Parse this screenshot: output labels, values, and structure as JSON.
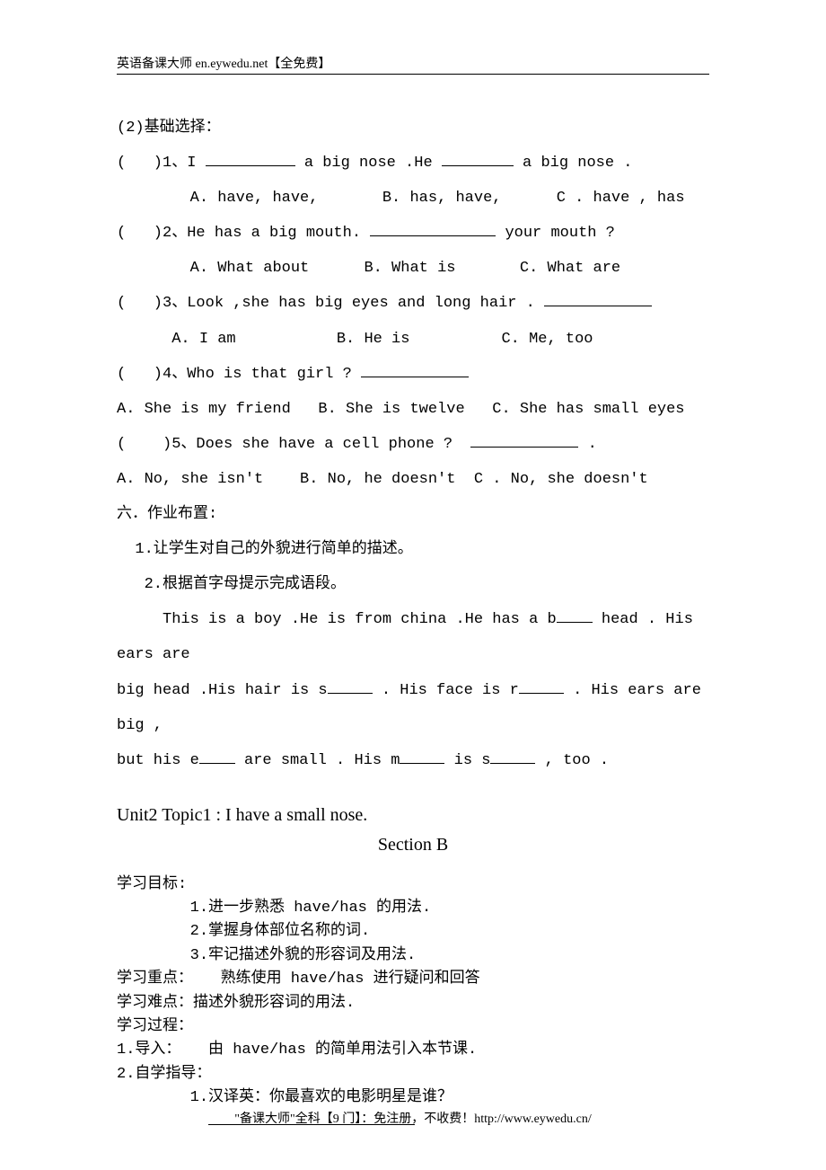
{
  "header": {
    "text": "英语备课大师  en.eywedu.net【全免费】"
  },
  "ex2": {
    "title": "(2)基础选择：",
    "q1": {
      "stem_a": "(   )1、I ",
      "stem_b": " a big nose .He ",
      "stem_c": " a big nose .",
      "opts": "        A. have, have,       B. has, have,      C . have , has"
    },
    "q2": {
      "stem_a": "(   )2、He has a big mouth. ",
      "stem_b": " your mouth ?",
      "opts": "        A. What about      B. What is       C. What are"
    },
    "q3": {
      "stem_a": "(   )3、Look ,she has big eyes and long hair . ",
      "opts": "      A. I am           B. He is          C. Me, too"
    },
    "q4": {
      "stem_a": "(   )4、Who is that girl ? ",
      "opts": "A. She is my friend   B. She is twelve   C. She has small eyes"
    },
    "q5": {
      "stem_a": "(    )5、Does she have a cell phone ?  ",
      "stem_b": " .",
      "opts": "A. No, she isn't    B. No, he doesn't  C . No, she doesn't"
    }
  },
  "hw": {
    "title": "六．作业布置:",
    "i1": "  1.让学生对自己的外貌进行简单的描述。",
    "i2": "   2.根据首字母提示完成语段。",
    "p_a": "     This is a boy .He is from china .He has a b",
    "p_b": " head . His ears are ",
    "p_c": "big head .His hair is s",
    "p_d": " . His face is r",
    "p_e": " . His ears are big , ",
    "p_f": "but his e",
    "p_g": " are small . His m",
    "p_h": " is s",
    "p_i": " , too ."
  },
  "unit": {
    "title": "Unit2  Topic1 : I  have a small nose.",
    "section": "Section B"
  },
  "goals": {
    "h1": "学习目标:",
    "g1": "        1.进一步熟悉 have/has 的用法.",
    "g2": "        2.掌握身体部位名称的词.",
    "g3": "        3.牢记描述外貌的形容词及用法.",
    "h2": "学习重点：   熟练使用 have/has 进行疑问和回答",
    "h3": "学习难点：描述外貌形容词的用法.",
    "h4": "学习过程：",
    "p1": "1.导入：   由 have/has 的简单用法引入本节课.",
    "p2": "2.自学指导：",
    "p3": "        1.汉译英：你最喜欢的电影明星是谁？"
  },
  "footer": {
    "text": "\"备课大师\"全科【9 门】：免注册，不收费！http://www.eywedu.cn/"
  }
}
